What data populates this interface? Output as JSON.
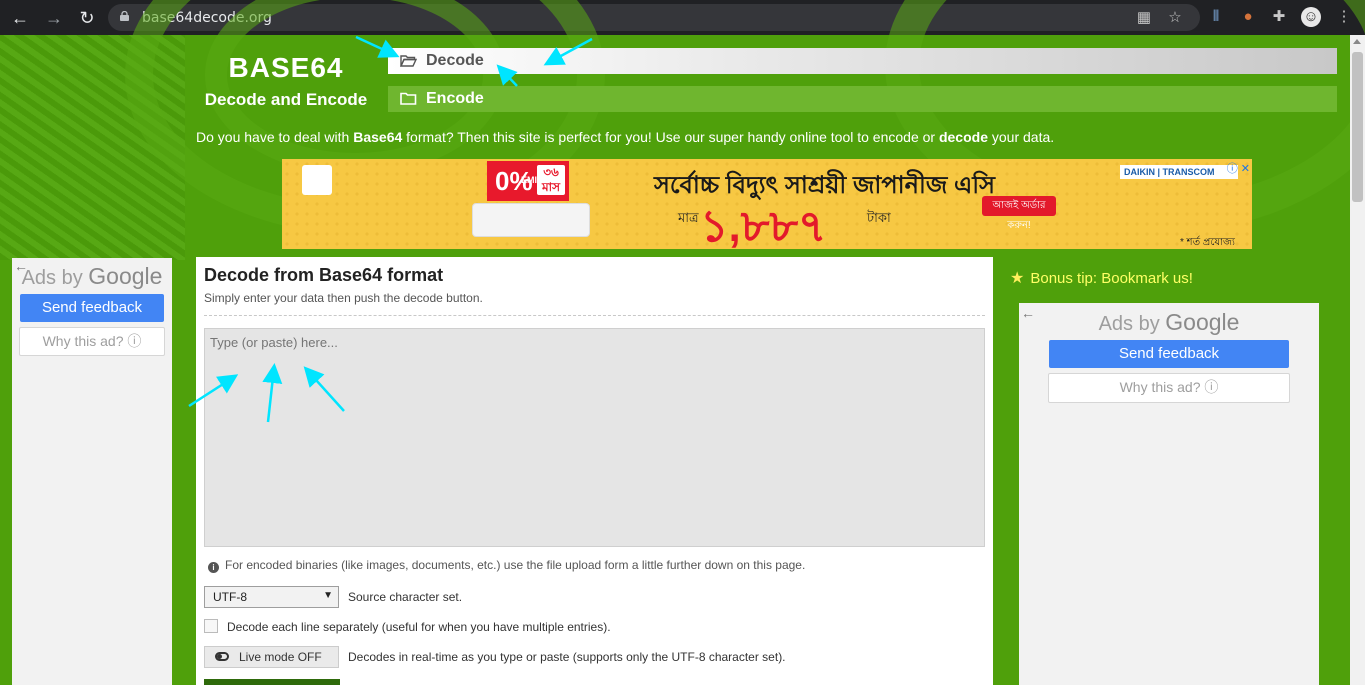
{
  "browser": {
    "url": "base64decode.org",
    "back_icon": "back-arrow-icon",
    "forward_icon": "forward-arrow-icon",
    "reload_icon": "reload-icon"
  },
  "header": {
    "brand_title": "BASE64",
    "brand_subtitle": "Decode and Encode",
    "tabs": [
      {
        "label": "Decode",
        "active": true
      },
      {
        "label": "Encode",
        "active": false
      }
    ]
  },
  "intro": {
    "p1": "Do you have to deal with ",
    "b1": "Base64",
    "p2": " format? Then this site is perfect for you! Use our super handy online tool to encode or ",
    "b2": "decode",
    "p3": " your data."
  },
  "banner": {
    "emi": "0%",
    "emi_small": "EMI",
    "months": "৩৬ মাস",
    "headline": "সর্বোচ্চ বিদ্যুৎ সাশ্রয়ী জাপানীজ এসি",
    "price_prefix": "মাত্র",
    "price": "১,৮৮৭",
    "price_suffix": "টাকা",
    "cta": "আজই অর্ডার করুন!",
    "brand": "DAIKIN | TRANSCOM",
    "note": "* শর্ত প্রযোজ্য"
  },
  "left_ad": {
    "ads_by": "Ads by ",
    "google": "Google",
    "send_feedback": "Send feedback",
    "why_ad": "Why this ad? ⓘ"
  },
  "main": {
    "title": "Decode from Base64 format",
    "subtitle": "Simply enter your data then push the decode button.",
    "textarea_placeholder": "Type (or paste) here...",
    "info": "For encoded binaries (like images, documents, etc.) use the file upload form a little further down on this page.",
    "charset_value": "UTF-8",
    "charset_label": "Source character set.",
    "each_line_label": "Decode each line separately (useful for when you have multiple entries).",
    "live_mode_label": "Live mode OFF",
    "live_mode_desc": "Decodes in real-time as you type or paste (supports only the UTF-8 character set)."
  },
  "right": {
    "bonus": "Bonus tip: Bookmark us!",
    "ads_by": "Ads by ",
    "google": "Google",
    "send_feedback": "Send feedback",
    "why_ad": "Why this ad? ⓘ"
  },
  "colors": {
    "page_green": "#4fa00b",
    "annotation_cyan": "#00e5ff",
    "google_blue": "#4285f4",
    "bonus_yellow": "#ffff66"
  }
}
